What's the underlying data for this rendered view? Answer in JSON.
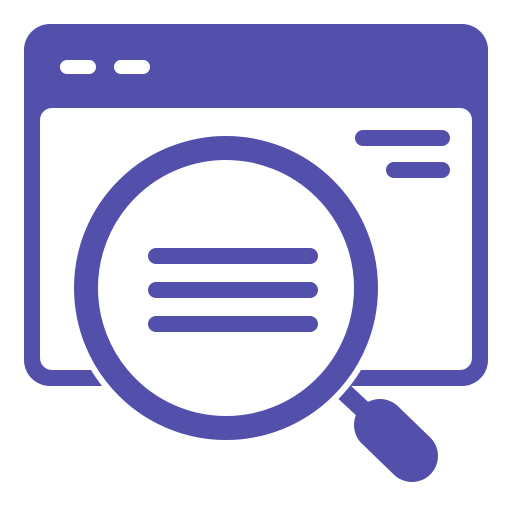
{
  "icon": {
    "name": "web-search-icon",
    "accent_color": "#5350AB",
    "background_color": "#FFFFFF"
  }
}
